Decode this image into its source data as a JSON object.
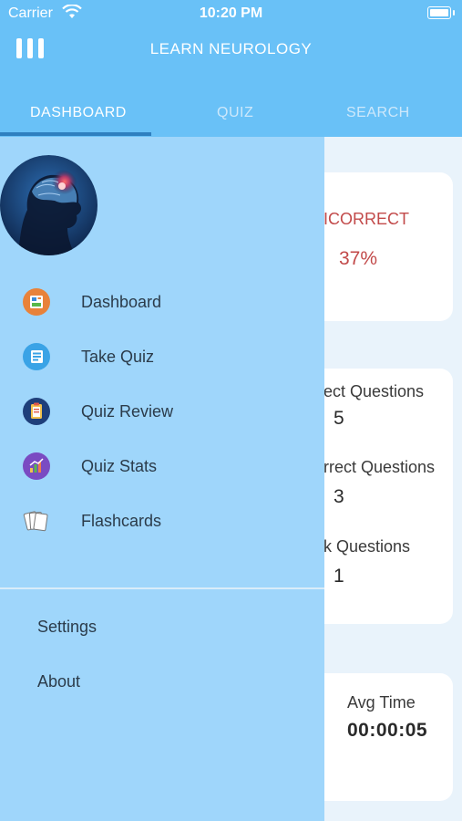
{
  "status_bar": {
    "carrier": "Carrier",
    "time": "10:20 PM"
  },
  "nav": {
    "title": "LEARN NEUROLOGY",
    "menu_icon": "menu-icon"
  },
  "tabs": [
    {
      "label": "DASHBOARD",
      "active": true
    },
    {
      "label": "QUIZ",
      "active": false
    },
    {
      "label": "SEARCH",
      "active": false
    }
  ],
  "dashboard": {
    "incorrect_label": "ICORRECT",
    "incorrect_value": "37%",
    "questions": [
      {
        "label": "ect Questions",
        "value": "5"
      },
      {
        "label": "rrect Questions",
        "value": "3"
      },
      {
        "label": "k Questions",
        "value": "1"
      }
    ],
    "avg_time_label": "Avg Time",
    "avg_time_value": "00:00:05"
  },
  "drawer": {
    "menu": [
      {
        "label": "Dashboard",
        "icon": "dashboard-icon"
      },
      {
        "label": "Take Quiz",
        "icon": "take-quiz-icon"
      },
      {
        "label": "Quiz Review",
        "icon": "clipboard-icon"
      },
      {
        "label": "Quiz Stats",
        "icon": "chart-icon"
      },
      {
        "label": "Flashcards",
        "icon": "cards-icon"
      }
    ],
    "settings_label": "Settings",
    "about_label": "About"
  },
  "colors": {
    "header": "#69c1f7",
    "drawer": "#9fd6fb",
    "incorrect": "#c24a4a",
    "tab_indicator": "#2f80c0"
  }
}
